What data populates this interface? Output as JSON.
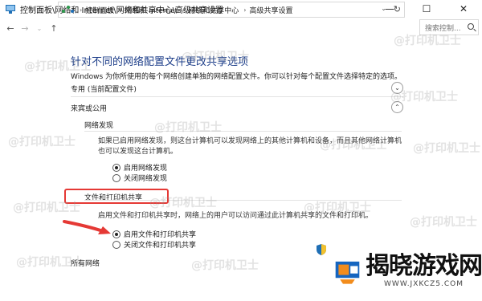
{
  "window": {
    "title": "控制面板\\网络和 Internet\\网络和共享中心\\高级共享设置",
    "min_glyph": "—",
    "max_glyph": "☐",
    "close_glyph": "✕"
  },
  "address": {
    "crumbs": [
      "控制面板",
      "网络和 Internet",
      "网络和共享中心",
      "高级共享设置"
    ],
    "separator": "›",
    "search_placeholder": "搜索控制..."
  },
  "page": {
    "title": "针对不同的网络配置文件更改共享选项",
    "description": "Windows 为你所使用的每个网络创建单独的网络配置文件。你可以针对每个配置文件选择特定的选项。"
  },
  "profiles": {
    "private": {
      "label": "专用 (当前配置文件)",
      "chevron": "⌄"
    },
    "guest": {
      "label": "来宾或公用",
      "chevron": "⌃"
    },
    "all": {
      "label": "所有网络",
      "chevron": "⌄"
    }
  },
  "network_discovery": {
    "heading": "网络发现",
    "description": "如果已启用网络发现，则这台计算机可以发现网络上的其他计算机和设备，而且其他网络计算机也可以发现这台计算机。",
    "options": [
      {
        "label": "启用网络发现",
        "selected": true
      },
      {
        "label": "关闭网络发现",
        "selected": false
      }
    ]
  },
  "file_printer_sharing": {
    "heading": "文件和打印机共享",
    "description": "启用文件和打印机共享时，网络上的用户可以访问通过此计算机共享的文件和打印机。",
    "options": [
      {
        "label": "启用文件和打印机共享",
        "selected": true
      },
      {
        "label": "关闭文件和打印机共享",
        "selected": false
      }
    ]
  },
  "watermark": {
    "text": "@打印机卫士"
  },
  "badge": {
    "name": "揭晓游戏网",
    "url": "WWW.JXKCZ5.COM"
  },
  "colors": {
    "accent_title": "#1e3f8a",
    "highlight": "#e53935",
    "badge_orange": "#f28c1c",
    "badge_blue": "#1565c0"
  }
}
